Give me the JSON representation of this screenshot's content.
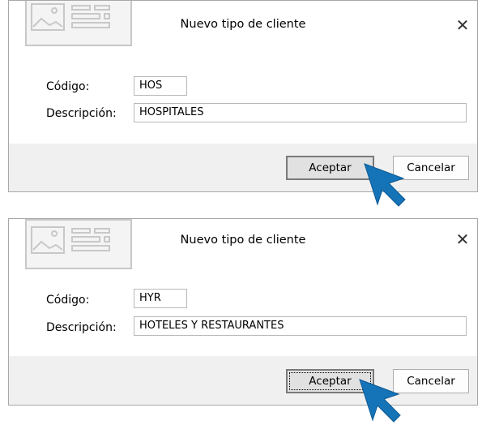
{
  "dialogs": [
    {
      "title": "Nuevo tipo de cliente",
      "close_symbol": "✕",
      "image_icon": "image-placeholder-icon",
      "fields": {
        "codigo_label": "Código:",
        "codigo_value": "HOS",
        "descripcion_label": "Descripción:",
        "descripcion_value": "HOSPITALES"
      },
      "buttons": {
        "accept": "Aceptar",
        "cancel": "Cancelar"
      }
    },
    {
      "title": "Nuevo tipo de cliente",
      "close_symbol": "✕",
      "image_icon": "image-placeholder-icon",
      "fields": {
        "codigo_label": "Código:",
        "codigo_value": "HYR",
        "descripcion_label": "Descripción:",
        "descripcion_value": "HOTELES Y RESTAURANTES"
      },
      "buttons": {
        "accept": "Aceptar",
        "cancel": "Cancelar"
      }
    }
  ],
  "cursor_icon": "pointer-arrow-icon",
  "colors": {
    "cursor_fill": "#1573b7",
    "footer_bg": "#f0f0f0",
    "border": "#a8a8a8"
  }
}
